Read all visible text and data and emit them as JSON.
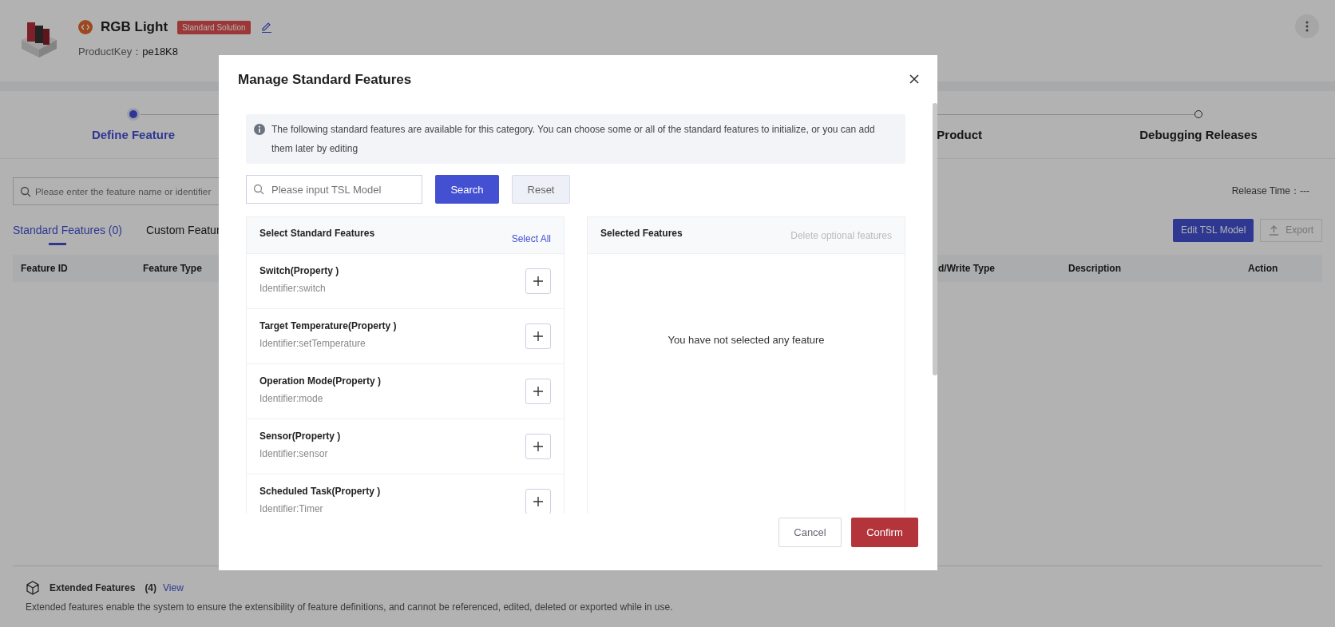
{
  "product": {
    "title": "RGB Light",
    "badge": "Standard Solution",
    "key_label": "ProductKey：",
    "key_value": "pe18K8"
  },
  "steps": [
    {
      "label": "Define Feature",
      "selected": true
    },
    {
      "label": "Product",
      "selected": false
    },
    {
      "label": "Debugging Releases",
      "selected": false
    }
  ],
  "toolbar": {
    "search_placeholder": "Please enter the feature name or identifier",
    "release_label": "Release Time：",
    "release_value": "---",
    "edit_button": "Edit TSL Model",
    "export_button": "Export",
    "export_disabled": true
  },
  "tabs": [
    {
      "label": "Standard Features (0)",
      "selected": true
    },
    {
      "label": "Custom Featur",
      "selected": false
    }
  ],
  "table": {
    "columns": [
      "Feature ID",
      "Feature Type",
      "d/Write Type",
      "Description",
      "Action"
    ]
  },
  "extended": {
    "title": "Extended Features",
    "count": "(4)",
    "link": "View",
    "description": "Extended features enable the system to ensure the extensibility of feature definitions, and cannot be referenced, edited, deleted or exported while in use."
  },
  "dialog": {
    "title": "Manage Standard Features",
    "notice": "The following standard features are available for this category. You can choose some or all of the standard features to initialize, or you can add them later by editing",
    "search_placeholder": "Please input TSL Model",
    "search_button": "Search",
    "reset_button": "Reset",
    "left_title": "Select Standard Features",
    "select_all": "Select All",
    "features": [
      {
        "name": "Switch(Property )",
        "identifier": "Identifier:switch"
      },
      {
        "name": "Target Temperature(Property )",
        "identifier": "Identifier:setTemperature"
      },
      {
        "name": "Operation Mode(Property )",
        "identifier": "Identifier:mode"
      },
      {
        "name": "Sensor(Property )",
        "identifier": "Identifier:sensor"
      },
      {
        "name": "Scheduled Task(Property )",
        "identifier": "Identifier:Timer"
      }
    ],
    "right_title": "Selected Features",
    "delete_optional": "Delete optional features",
    "empty_text": "You have not selected any feature",
    "cancel_button": "Cancel",
    "confirm_button": "Confirm"
  }
}
